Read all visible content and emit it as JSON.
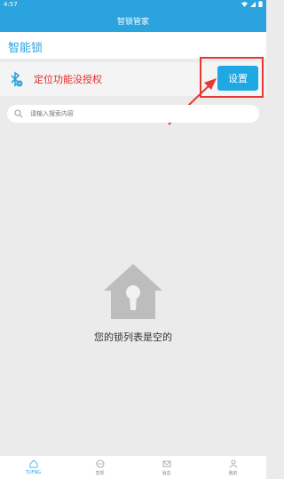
{
  "status_bar": {
    "time": "4:57"
  },
  "app_bar": {
    "title": "智锁管家"
  },
  "header": {
    "title": "智能锁"
  },
  "notice": {
    "message": "定位功能没授权",
    "settings_label": "设置"
  },
  "search": {
    "placeholder": "请输入搜索内容"
  },
  "empty_state": {
    "text": "您的锁列表是空的"
  },
  "bottom_nav": {
    "items": [
      {
        "label": "TUFNG",
        "icon": "home-icon",
        "active": true
      },
      {
        "label": "发现",
        "icon": "discover-icon",
        "active": false
      },
      {
        "label": "消息",
        "icon": "mail-icon",
        "active": false
      },
      {
        "label": "我的",
        "icon": "user-icon",
        "active": false
      }
    ]
  },
  "colors": {
    "primary": "#2aa3df",
    "alert": "#e52a2a",
    "highlight": "#e53935"
  }
}
